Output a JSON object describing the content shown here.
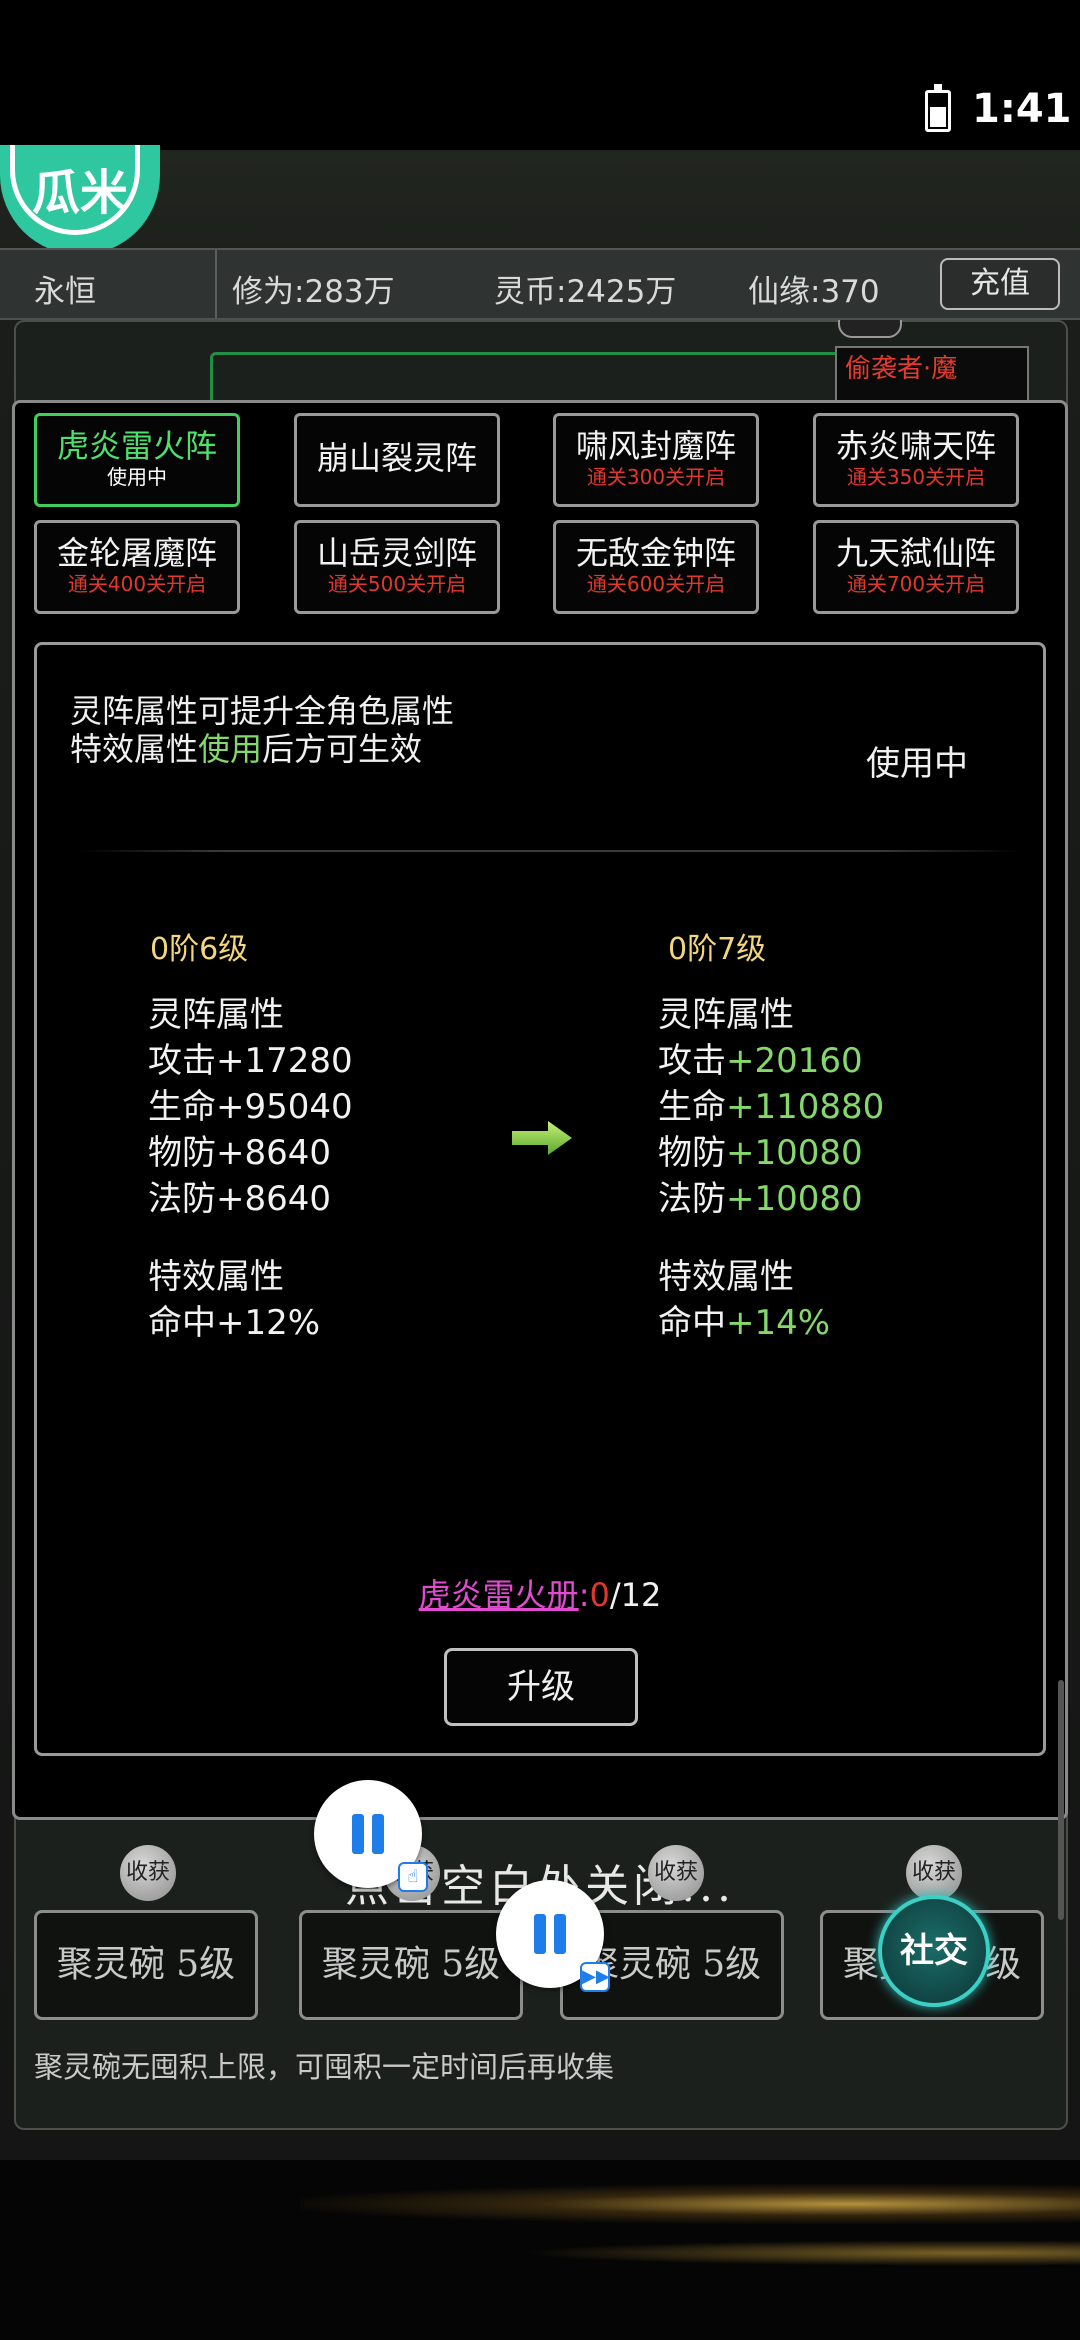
{
  "status_bar": {
    "time": "1:41",
    "battery_icon": "battery-icon"
  },
  "logo": {
    "text": "瓜米"
  },
  "info_bar": {
    "player_name": "永恒",
    "cultivation": "修为:283万",
    "spirit_coins": "灵币:2425万",
    "fate": "仙缘:370",
    "recharge_label": "充值"
  },
  "background": {
    "enemy_label": "偷袭者·魔"
  },
  "formations": [
    {
      "name": "虎炎雷火阵",
      "sub": "使用中",
      "active": true
    },
    {
      "name": "崩山裂灵阵",
      "sub": "",
      "active": false
    },
    {
      "name": "啸风封魔阵",
      "sub": "通关300关开启",
      "active": false
    },
    {
      "name": "赤炎啸天阵",
      "sub": "通关350关开启",
      "active": false
    },
    {
      "name": "金轮屠魔阵",
      "sub": "通关400关开启",
      "active": false
    },
    {
      "name": "山岳灵剑阵",
      "sub": "通关500关开启",
      "active": false
    },
    {
      "name": "无敌金钟阵",
      "sub": "通关600关开启",
      "active": false
    },
    {
      "name": "九天弑仙阵",
      "sub": "通关700关开启",
      "active": false
    }
  ],
  "detail": {
    "desc_line1": "灵阵属性可提升全角色属性",
    "desc_line2_prefix": "特效属性",
    "desc_line2_highlight": "使用",
    "desc_line2_suffix": "后方可生效",
    "status": "使用中",
    "current": {
      "rank": "0阶6级",
      "section1": "灵阵属性",
      "attrs": [
        {
          "label": "攻击",
          "value": "+17280"
        },
        {
          "label": "生命",
          "value": "+95040"
        },
        {
          "label": "物防",
          "value": "+8640"
        },
        {
          "label": "法防",
          "value": "+8640"
        }
      ],
      "section2": "特效属性",
      "special": {
        "label": "命中",
        "value": "+12%"
      }
    },
    "next": {
      "rank": "0阶7级",
      "section1": "灵阵属性",
      "attrs": [
        {
          "label": "攻击",
          "value": "+20160"
        },
        {
          "label": "生命",
          "value": "+110880"
        },
        {
          "label": "物防",
          "value": "+10080"
        },
        {
          "label": "法防",
          "value": "+10080"
        }
      ],
      "section2": "特效属性",
      "special": {
        "label": "命中",
        "value": "+14%"
      }
    },
    "arrow_icon": "arrow-right-icon",
    "book": {
      "name": "虎炎雷火册",
      "separator": ":",
      "have": "0",
      "need": "/12"
    },
    "upgrade_label": "升级"
  },
  "lower": {
    "close_hint": "点击空白处关闭...",
    "harvest_label": "收获",
    "bowls": [
      "聚灵碗 5级",
      "聚灵碗 5级",
      "聚灵碗 5级",
      "聚灵碗 5级"
    ],
    "tip": "聚灵碗无囤积上限，可囤积一定时间后再收集"
  },
  "social_label": "社交",
  "colors": {
    "active_green": "#4fe06a",
    "locked_red": "#e0372e",
    "rank_gold": "#f4d77a",
    "book_magenta": "#e04bd0"
  }
}
